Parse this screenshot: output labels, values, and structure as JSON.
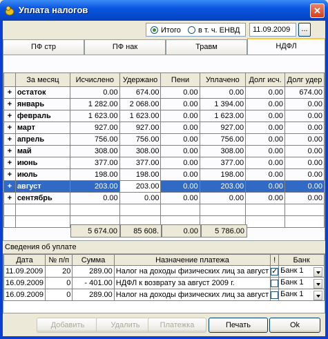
{
  "window": {
    "title": "Уплата налогов",
    "close_glyph": "✕"
  },
  "options": {
    "radio_total": "Итого",
    "radio_envd": "в т. ч. ЕНВД",
    "selected": "total",
    "date": "11.09.2009",
    "dots": "..."
  },
  "tabs": [
    "ПФ стр",
    "ПФ нак",
    "Травм",
    "НДФЛ"
  ],
  "active_tab": 3,
  "grid": {
    "columns": [
      "За месяц",
      "Исчислено",
      "Удержано",
      "Пени",
      "Уплачено",
      "Долг исч.",
      "Долг удер"
    ],
    "rows": [
      {
        "plus": "+",
        "name": "остаток",
        "calc": "0.00",
        "held": "674.00",
        "peni": "0.00",
        "paid": "0.00",
        "debt_c": "0.00",
        "debt_h": "674.00"
      },
      {
        "plus": "+",
        "name": "январь",
        "calc": "1 282.00",
        "held": "2 068.00",
        "peni": "0.00",
        "paid": "1 394.00",
        "debt_c": "0.00",
        "debt_h": "0.00"
      },
      {
        "plus": "+",
        "name": "февраль",
        "calc": "1 623.00",
        "held": "1 623.00",
        "peni": "0.00",
        "paid": "1 623.00",
        "debt_c": "0.00",
        "debt_h": "0.00"
      },
      {
        "plus": "+",
        "name": "март",
        "calc": "927.00",
        "held": "927.00",
        "peni": "0.00",
        "paid": "927.00",
        "debt_c": "0.00",
        "debt_h": "0.00"
      },
      {
        "plus": "+",
        "name": "апрель",
        "calc": "756.00",
        "held": "756.00",
        "peni": "0.00",
        "paid": "756.00",
        "debt_c": "0.00",
        "debt_h": "0.00"
      },
      {
        "plus": "+",
        "name": "май",
        "calc": "308.00",
        "held": "308.00",
        "peni": "0.00",
        "paid": "308.00",
        "debt_c": "0.00",
        "debt_h": "0.00"
      },
      {
        "plus": "+",
        "name": "июнь",
        "calc": "377.00",
        "held": "377.00",
        "peni": "0.00",
        "paid": "377.00",
        "debt_c": "0.00",
        "debt_h": "0.00"
      },
      {
        "plus": "+",
        "name": "июль",
        "calc": "198.00",
        "held": "198.00",
        "peni": "0.00",
        "paid": "198.00",
        "debt_c": "0.00",
        "debt_h": "0.00"
      },
      {
        "plus": "+",
        "name": "август",
        "calc": "203.00",
        "held": "203.00",
        "peni": "0.00",
        "paid": "203.00",
        "debt_c": "0.00",
        "debt_h": "0.00",
        "selected": true
      },
      {
        "plus": "+",
        "name": "сентябрь",
        "calc": "0.00",
        "held": "0.00",
        "peni": "0.00",
        "paid": "0.00",
        "debt_c": "0.00",
        "debt_h": "0.00"
      }
    ],
    "totals": {
      "calc": "5 674.00",
      "held": "85 608.",
      "peni": "0.00",
      "paid": "5 786.00"
    }
  },
  "payments": {
    "caption": "Сведения об уплате",
    "columns": [
      "Дата",
      "№ п/п",
      "Сумма",
      "Назначение платежа",
      "!",
      "Банк"
    ],
    "rows": [
      {
        "date": "11.09.2009",
        "num": "20",
        "sum": "289.00",
        "purpose": "Налог на доходы физических лиц за август",
        "checked": true,
        "bank": "Банк 1"
      },
      {
        "date": "16.09.2009",
        "num": "0",
        "sum": "- 401.00",
        "purpose": "НДФЛ к возврату за август 2009 г.",
        "checked": false,
        "bank": "Банк 1"
      },
      {
        "date": "16.09.2009",
        "num": "0",
        "sum": "289.00",
        "purpose": "Налог на доходы физических лиц за август",
        "checked": false,
        "bank": "Банк 1"
      }
    ]
  },
  "buttons": {
    "add": "Добавить",
    "delete": "Удалить",
    "payment": "Платежка",
    "print": "Печать",
    "ok": "Ok"
  }
}
